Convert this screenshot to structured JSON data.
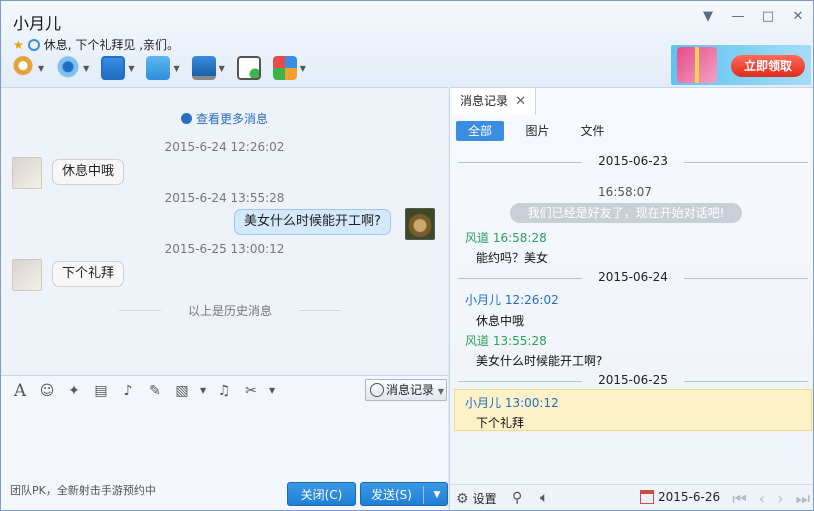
{
  "header": {
    "title": "小月儿",
    "signature": "休息, 下个礼拜见 ,亲们。",
    "banner_button": "立即领取"
  },
  "chat": {
    "more_messages": "查看更多消息",
    "messages": [
      {
        "time": "2015-6-24 12:26:02",
        "text": "休息中哦",
        "side": "left"
      },
      {
        "time": "2015-6-24 13:55:28",
        "text": "美女什么时候能开工啊?",
        "side": "right"
      },
      {
        "time": "2015-6-25 13:00:12",
        "text": "下个礼拜",
        "side": "left"
      }
    ],
    "history_divider": "以上是历史消息"
  },
  "input": {
    "message_record_button": "消息记录",
    "ad_text": "团队PK，全新射击手游预约中",
    "close_button": "关闭(C)",
    "send_button": "发送(S)"
  },
  "history": {
    "tab_label": "消息记录",
    "filters": [
      "全部",
      "图片",
      "文件"
    ],
    "entries": {
      "date1": "2015-06-23",
      "time1": "16:58:07",
      "system_msg": "我们已经是好友了，现在开始对话吧!",
      "s1_sender": "风道  16:58:28",
      "s1_text": "能约吗？美女",
      "date2": "2015-06-24",
      "s2_sender": "小月儿  12:26:02",
      "s2_text": "休息中哦",
      "s3_sender": "风道  13:55:28",
      "s3_text": "美女什么时候能开工啊?",
      "date3": "2015-06-25",
      "s4_sender": "小月儿  13:00:12",
      "s4_text": "下个礼拜"
    },
    "footer": {
      "settings": "设置",
      "date": "2015-6-26"
    }
  },
  "colors": {
    "accent": "#3a8de0",
    "other_sender": "#2aa05a",
    "me_sender": "#1f6fc5",
    "highlight": "#fdf1c7"
  }
}
